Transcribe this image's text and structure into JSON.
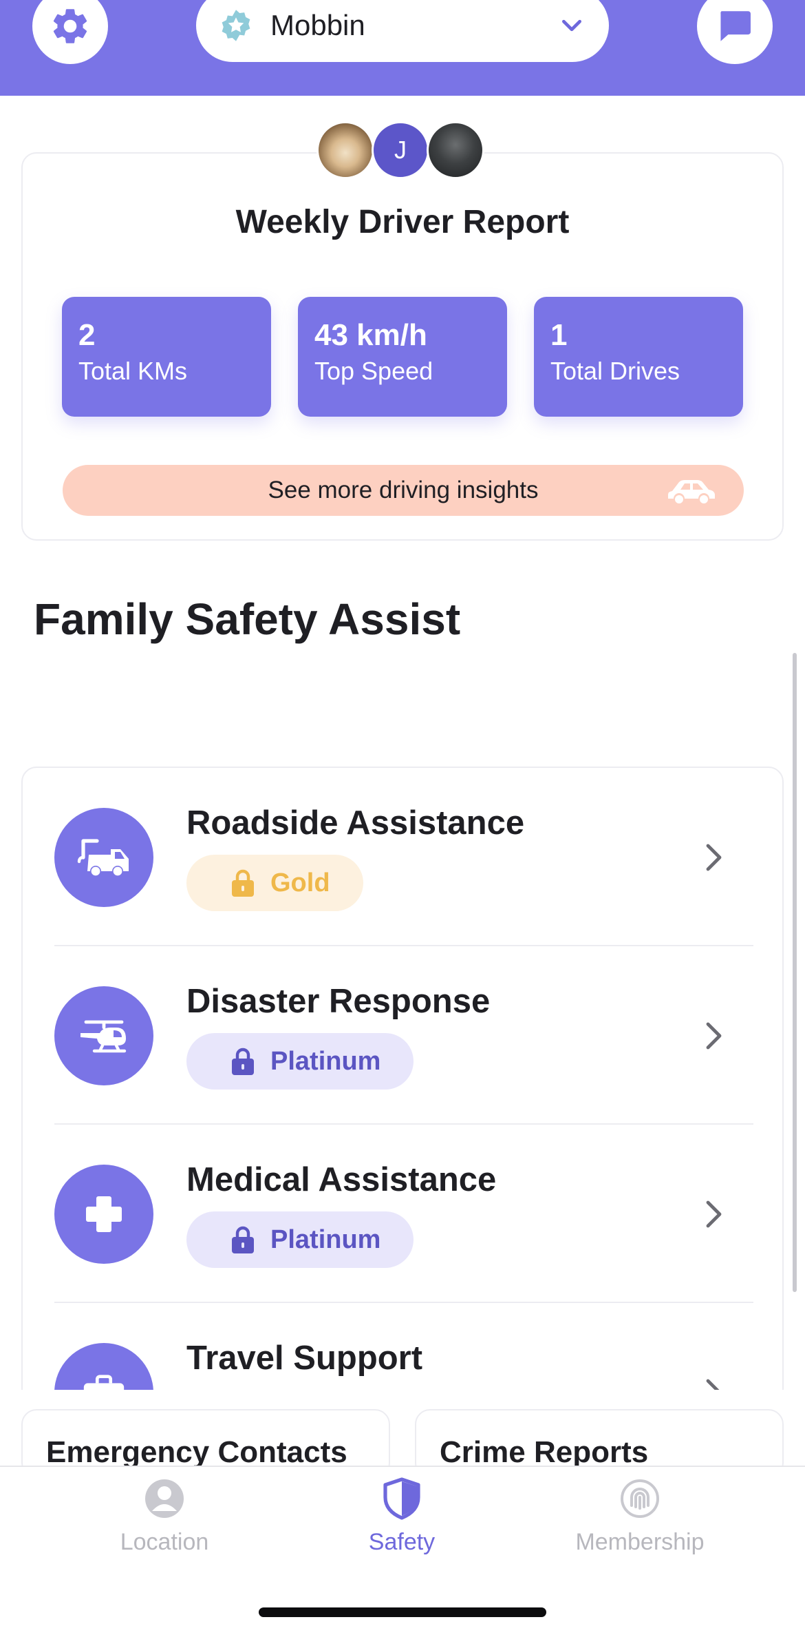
{
  "header": {
    "circle_name": "Mobbin",
    "settings_icon": "gear-icon",
    "messages_icon": "chat-icon",
    "colors": {
      "brand": "#7a74e6",
      "star": "#8fcbd9"
    }
  },
  "report": {
    "avatar_initial": "J",
    "title": "Weekly Driver Report",
    "stats": [
      {
        "value": "2",
        "label": "Total KMs"
      },
      {
        "value": "43 km/h",
        "label": "Top Speed"
      },
      {
        "value": "1",
        "label": "Total Drives"
      }
    ],
    "insights_label": "See more driving insights"
  },
  "section_title": "Family Safety Assist",
  "features": [
    {
      "title": "Roadside Assistance",
      "badge": "Gold",
      "icon": "tow-truck-icon"
    },
    {
      "title": "Disaster Response",
      "badge": "Platinum",
      "icon": "helicopter-icon"
    },
    {
      "title": "Medical Assistance",
      "badge": "Platinum",
      "icon": "medical-cross-icon"
    },
    {
      "title": "Travel Support",
      "badge": "",
      "icon": "briefcase-icon"
    }
  ],
  "cards": {
    "emergency_contacts": "Emergency Contacts",
    "crime_reports": "Crime Reports"
  },
  "tabs": [
    {
      "label": "Location",
      "active": false
    },
    {
      "label": "Safety",
      "active": true
    },
    {
      "label": "Membership",
      "active": false
    }
  ]
}
